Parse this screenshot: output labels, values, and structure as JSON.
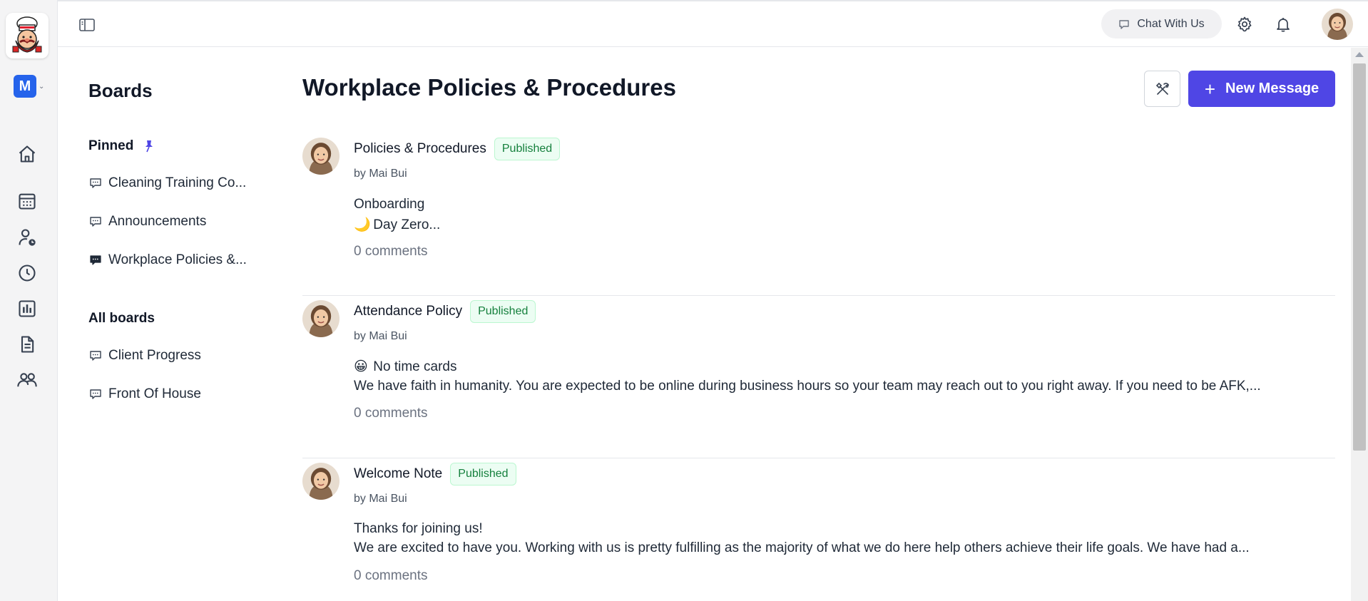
{
  "rail": {
    "workspace_initial": "M",
    "icons": [
      "home-icon",
      "calendar-icon",
      "user-clock-icon",
      "clock-icon",
      "bar-chart-icon",
      "document-icon",
      "team-icon"
    ]
  },
  "topbar": {
    "chat_label": "Chat With Us"
  },
  "boards": {
    "title": "Boards",
    "pinned_label": "Pinned",
    "pinned": [
      {
        "label": "Cleaning Training Co...",
        "active": false
      },
      {
        "label": "Announcements",
        "active": false
      },
      {
        "label": "Workplace Policies &...",
        "active": true
      }
    ],
    "all_label": "All boards",
    "all": [
      {
        "label": "Client Progress"
      },
      {
        "label": "Front Of House"
      }
    ]
  },
  "main": {
    "title": "Workplace Policies & Procedures",
    "new_message_label": "New Message",
    "posts": [
      {
        "title": "Policies & Procedures",
        "status": "Published",
        "author": "by Mai Bui",
        "line1": "Onboarding",
        "line2_emoji": "🌙",
        "line2": "Day Zero...",
        "comments": "0 comments"
      },
      {
        "title": "Attendance Policy",
        "status": "Published",
        "author": "by Mai Bui",
        "line1_emoji": "😀",
        "line1": "No time cards",
        "line2": "We have faith in humanity. You are expected to be online during business hours so your team may reach out to you right away. If you need to be AFK,...",
        "comments": "0 comments"
      },
      {
        "title": "Welcome Note",
        "status": "Published",
        "author": "by Mai Bui",
        "line1": "Thanks for joining us!",
        "line2": "We are excited to have you. Working with us is pretty fulfilling as the majority of what we do here help others achieve their life goals. We have had a...",
        "comments": "0 comments"
      }
    ]
  },
  "colors": {
    "accent": "#4f46e5",
    "published_text": "#15803d",
    "published_bg": "#ecfdf3",
    "workspace": "#2563eb"
  }
}
